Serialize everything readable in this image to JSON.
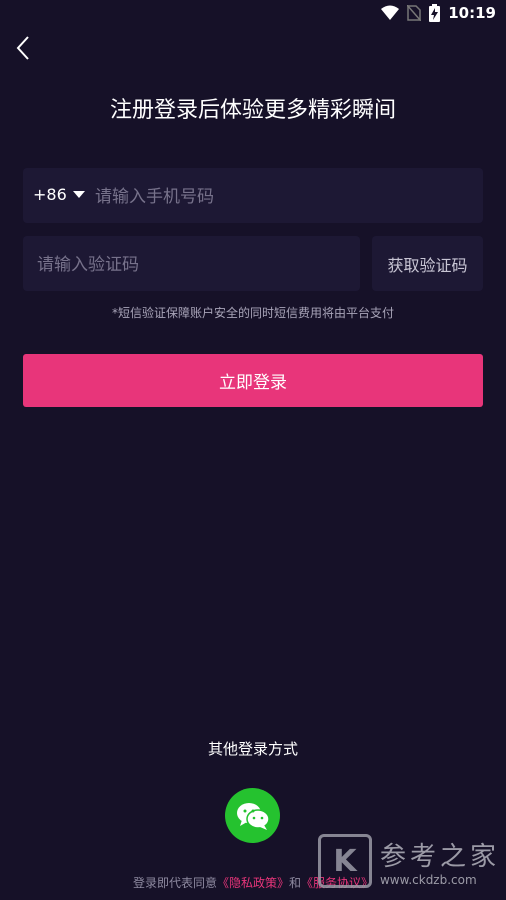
{
  "status_bar": {
    "time": "10:19"
  },
  "page": {
    "title": "注册登录后体验更多精彩瞬间"
  },
  "phone": {
    "country_code": "+86",
    "placeholder": "请输入手机号码"
  },
  "code": {
    "placeholder": "请输入验证码",
    "get_code_label": "获取验证码"
  },
  "notice": "*短信验证保障账户安全的同时短信费用将由平台支付",
  "login_button": "立即登录",
  "other_login": {
    "title": "其他登录方式"
  },
  "agreement": {
    "prefix": "登录即代表同意",
    "privacy_link": "《隐私政策》",
    "conjunction": "和",
    "service_link": "《服务协议》"
  },
  "watermark": {
    "logo_letter": "K",
    "name": "参考之家",
    "url": "www.ckdzb.com"
  }
}
